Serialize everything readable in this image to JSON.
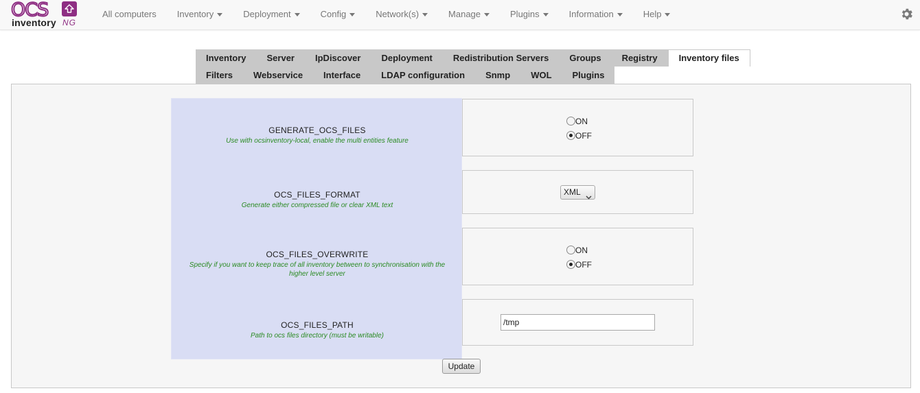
{
  "brand": {
    "logo_top": "OCS",
    "logo_bottom": "inventory",
    "logo_suffix": "NG",
    "brand_color": "#8e2e83"
  },
  "nav": {
    "items": [
      {
        "label": "All computers",
        "dropdown": false
      },
      {
        "label": "Inventory",
        "dropdown": true
      },
      {
        "label": "Deployment",
        "dropdown": true
      },
      {
        "label": "Config",
        "dropdown": true
      },
      {
        "label": "Network(s)",
        "dropdown": true
      },
      {
        "label": "Manage",
        "dropdown": true
      },
      {
        "label": "Plugins",
        "dropdown": true
      },
      {
        "label": "Information",
        "dropdown": true
      },
      {
        "label": "Help",
        "dropdown": true
      }
    ],
    "settings_icon": "gear-icon"
  },
  "tabs": {
    "row1": [
      "Inventory",
      "Server",
      "IpDiscover",
      "Deployment",
      "Redistribution Servers",
      "Groups",
      "Registry",
      "Inventory files"
    ],
    "row2": [
      "Filters",
      "Webservice",
      "Interface",
      "LDAP configuration",
      "Snmp",
      "WOL",
      "Plugins"
    ],
    "active": "Inventory files"
  },
  "settings": [
    {
      "name": "GENERATE_OCS_FILES",
      "description": "Use with ocsinventory-local, enable the multi entities feature",
      "type": "radio",
      "options": [
        "ON",
        "OFF"
      ],
      "selected": "OFF"
    },
    {
      "name": "OCS_FILES_FORMAT",
      "description": "Generate either compressed file or clear XML text",
      "type": "select",
      "value": "XML"
    },
    {
      "name": "OCS_FILES_OVERWRITE",
      "description": "Specify if you want to keep trace of all inventory between to synchronisation with the higher level server",
      "type": "radio",
      "options": [
        "ON",
        "OFF"
      ],
      "selected": "OFF"
    },
    {
      "name": "OCS_FILES_PATH",
      "description": "Path to ocs files directory (must be writable)",
      "type": "text",
      "value": "/tmp"
    }
  ],
  "update_label": "Update",
  "colors": {
    "label_bg": "#d9ddf4",
    "desc_text": "#2a8a22",
    "tab_bg": "#c8c8c8"
  }
}
